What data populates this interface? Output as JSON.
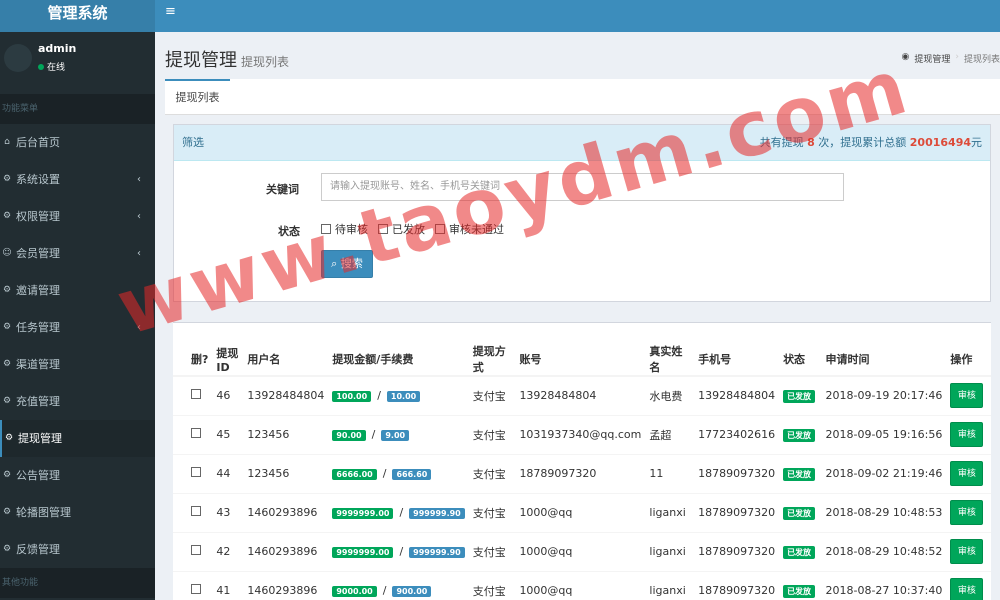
{
  "app": {
    "title": "管理系统"
  },
  "user": {
    "name": "admin",
    "status": "在线"
  },
  "sidebar": {
    "header": "功能菜单",
    "items": [
      {
        "label": "后台首页",
        "icon": "home-icon",
        "chevron": false
      },
      {
        "label": "系统设置",
        "icon": "cogs-icon",
        "chevron": true
      },
      {
        "label": "权限管理",
        "icon": "cogs-icon",
        "chevron": true
      },
      {
        "label": "会员管理",
        "icon": "users-icon",
        "chevron": true
      },
      {
        "label": "邀请管理",
        "icon": "cogs-icon",
        "chevron": false
      },
      {
        "label": "任务管理",
        "icon": "cogs-icon",
        "chevron": true
      },
      {
        "label": "渠道管理",
        "icon": "cogs-icon",
        "chevron": false
      },
      {
        "label": "充值管理",
        "icon": "cogs-icon",
        "chevron": false
      },
      {
        "label": "提现管理",
        "icon": "cogs-icon",
        "chevron": false,
        "active": true
      },
      {
        "label": "公告管理",
        "icon": "cogs-icon",
        "chevron": false
      },
      {
        "label": "轮播图管理",
        "icon": "cogs-icon",
        "chevron": false
      },
      {
        "label": "反馈管理",
        "icon": "cogs-icon",
        "chevron": false
      }
    ],
    "footer_header": "其他功能"
  },
  "page": {
    "title": "提现管理",
    "subtitle": "提现列表",
    "breadcrumb": {
      "home": "提现管理",
      "current": "提现列表"
    }
  },
  "tabs": [
    {
      "label": "提现列表"
    }
  ],
  "filter": {
    "title": "筛选",
    "summary_prefix": "共有提现",
    "count": "8",
    "summary_mid": "次，提现累计总额",
    "total": "20016494",
    "summary_suffix": "元",
    "keyword_label": "关键词",
    "keyword_placeholder": "请输入提现账号、姓名、手机号关键词",
    "status_label": "状态",
    "status_options": [
      "待审核",
      "已发放",
      "审核未通过"
    ],
    "search_label": "搜索"
  },
  "table": {
    "headers": [
      "删?",
      "提现ID",
      "用户名",
      "提现金额/手续费",
      "提现方式",
      "账号",
      "真实姓名",
      "手机号",
      "状态",
      "申请时间",
      "操作"
    ],
    "rows": [
      {
        "id": "46",
        "username": "13928484804",
        "amount": "100.00",
        "fee": "10.00",
        "method": "支付宝",
        "account": "13928484804",
        "realname": "水电费",
        "phone": "13928484804",
        "status": "已发放",
        "time": "2018-09-19 20:17:46",
        "action": "审核"
      },
      {
        "id": "45",
        "username": "123456",
        "amount": "90.00",
        "fee": "9.00",
        "method": "支付宝",
        "account": "1031937340@qq.com",
        "realname": "孟超",
        "phone": "17723402616",
        "status": "已发放",
        "time": "2018-09-05 19:16:56",
        "action": "审核"
      },
      {
        "id": "44",
        "username": "123456",
        "amount": "6666.00",
        "fee": "666.60",
        "method": "支付宝",
        "account": "18789097320",
        "realname": "11",
        "phone": "18789097320",
        "status": "已发放",
        "time": "2018-09-02 21:19:46",
        "action": "审核"
      },
      {
        "id": "43",
        "username": "1460293896",
        "amount": "9999999.00",
        "fee": "999999.90",
        "method": "支付宝",
        "account": "1000@qq",
        "realname": "liganxi",
        "phone": "18789097320",
        "status": "已发放",
        "time": "2018-08-29 10:48:53",
        "action": "审核"
      },
      {
        "id": "42",
        "username": "1460293896",
        "amount": "9999999.00",
        "fee": "999999.90",
        "method": "支付宝",
        "account": "1000@qq",
        "realname": "liganxi",
        "phone": "18789097320",
        "status": "已发放",
        "time": "2018-08-29 10:48:52",
        "action": "审核"
      },
      {
        "id": "41",
        "username": "1460293896",
        "amount": "9000.00",
        "fee": "900.00",
        "method": "支付宝",
        "account": "1000@qq",
        "realname": "liganxi",
        "phone": "18789097320",
        "status": "已发放",
        "time": "2018-08-27 10:37:40",
        "action": "审核"
      }
    ]
  },
  "watermark": "www.taoydm.com",
  "colors": {
    "sidebar": "#222d32",
    "topbar": "#3c8dbc",
    "success": "#00a65a",
    "primary": "#3c8dbc",
    "danger": "#dd4b39"
  }
}
